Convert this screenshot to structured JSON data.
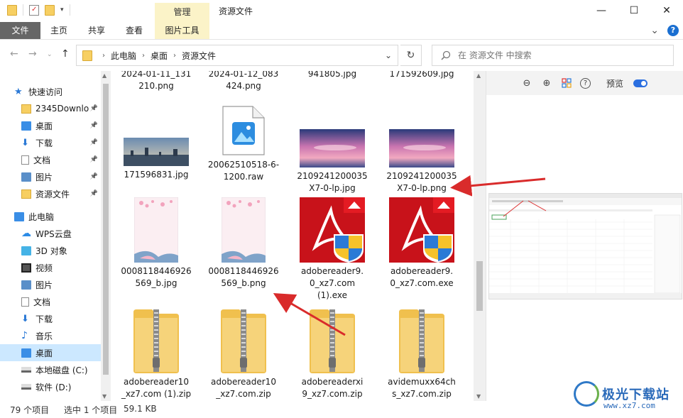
{
  "window": {
    "title": "资源文件",
    "context_tab_label": "管理",
    "minimize_glyph": "—",
    "maximize_glyph": "☐",
    "close_glyph": "✕"
  },
  "ribbon": {
    "tabs": [
      "文件",
      "主页",
      "共享",
      "查看",
      "图片工具"
    ],
    "expand_glyph": "⌄",
    "help_glyph": "?"
  },
  "address": {
    "crumbs": [
      "此电脑",
      "桌面",
      "资源文件"
    ],
    "dropdown_glyph": "⌄",
    "refresh_glyph": "↻"
  },
  "search": {
    "placeholder": "在 资源文件 中搜索",
    "icon": "search-icon"
  },
  "sidebar": {
    "items": [
      {
        "label": "快速访问",
        "icon": "star-icon",
        "pinned": false,
        "color": "#2b79d6"
      },
      {
        "label": "2345Downlo",
        "icon": "folder-icon",
        "pinned": true,
        "color": "#f7cf62"
      },
      {
        "label": "桌面",
        "icon": "desktop-icon",
        "pinned": true,
        "color": "#3a8ee6"
      },
      {
        "label": "下载",
        "icon": "download-icon",
        "pinned": true,
        "color": "#2b79d6"
      },
      {
        "label": "文档",
        "icon": "document-icon",
        "pinned": true,
        "color": "#8c8c8c"
      },
      {
        "label": "图片",
        "icon": "pictures-icon",
        "pinned": true,
        "color": "#5a8fc9"
      },
      {
        "label": "资源文件",
        "icon": "folder-icon",
        "pinned": true,
        "color": "#f7cf62"
      },
      {
        "label": "此电脑",
        "icon": "computer-icon",
        "pinned": false,
        "color": "#3a8ee6"
      },
      {
        "label": "WPS云盘",
        "icon": "cloud-icon",
        "pinned": false,
        "color": "#2b8be6"
      },
      {
        "label": "3D 对象",
        "icon": "cube-icon",
        "pinned": false,
        "color": "#45b3e6"
      },
      {
        "label": "视频",
        "icon": "video-icon",
        "pinned": false,
        "color": "#555"
      },
      {
        "label": "图片",
        "icon": "pictures-icon",
        "pinned": false,
        "color": "#5a8fc9"
      },
      {
        "label": "文档",
        "icon": "document-icon",
        "pinned": false,
        "color": "#8c8c8c"
      },
      {
        "label": "下载",
        "icon": "download-icon",
        "pinned": false,
        "color": "#2b79d6"
      },
      {
        "label": "音乐",
        "icon": "music-icon",
        "pinned": false,
        "color": "#2b79d6"
      },
      {
        "label": "桌面",
        "icon": "desktop-icon",
        "pinned": false,
        "color": "#3a8ee6",
        "selected": true
      },
      {
        "label": "本地磁盘 (C:)",
        "icon": "drive-icon",
        "pinned": false,
        "color": "#666"
      },
      {
        "label": "软件 (D:)",
        "icon": "drive-icon",
        "pinned": false,
        "color": "#666"
      }
    ]
  },
  "files": [
    {
      "name": "2024-01-11_131\n210.png",
      "type": "cut"
    },
    {
      "name": "2024-01-12_083\n424.png",
      "type": "cut"
    },
    {
      "name": "941805.jpg",
      "type": "cut"
    },
    {
      "name": "171592609.jpg",
      "type": "cut"
    },
    {
      "name": "171596831.jpg",
      "type": "city"
    },
    {
      "name": "2006251051​8-6-\n1200.raw",
      "type": "raw"
    },
    {
      "name": "2109241200035\nX7-0-lp.jpg",
      "type": "sky"
    },
    {
      "name": "2109241200035\nX7-0-lp.png",
      "type": "sky"
    },
    {
      "name": "0008118446926\n569_b.jpg",
      "type": "blossom"
    },
    {
      "name": "0008118446926\n569_b.png",
      "type": "blossom"
    },
    {
      "name": "adobereader9.\n0_xz7.com\n(1).exe",
      "type": "adobe"
    },
    {
      "name": "adobereader9.\n0_xz7.com.exe",
      "type": "adobe"
    },
    {
      "name": "adobereader10\n_xz7.com (1).zip",
      "type": "zip"
    },
    {
      "name": "adobereader10\n_xz7.com.zip",
      "type": "zip"
    },
    {
      "name": "adobereaderxi\n9_xz7.com.zip",
      "type": "zip"
    },
    {
      "name": "avidemuxx64ch\ns_xz7.com.zip",
      "type": "zip"
    }
  ],
  "preview": {
    "label": "预览",
    "zoom_out_glyph": "⊖",
    "zoom_in_glyph": "⊕",
    "help_glyph": "?",
    "toggle_on": true
  },
  "status": {
    "count": "79 个项目",
    "selected": "选中 1 个项目",
    "size": "59.1 KB"
  },
  "watermark": {
    "text": "极光下载站",
    "url": "www.xz7.com"
  },
  "colors": {
    "accent": "#2b79d6",
    "arrow": "#d92b2b",
    "selection": "#cce8ff"
  }
}
